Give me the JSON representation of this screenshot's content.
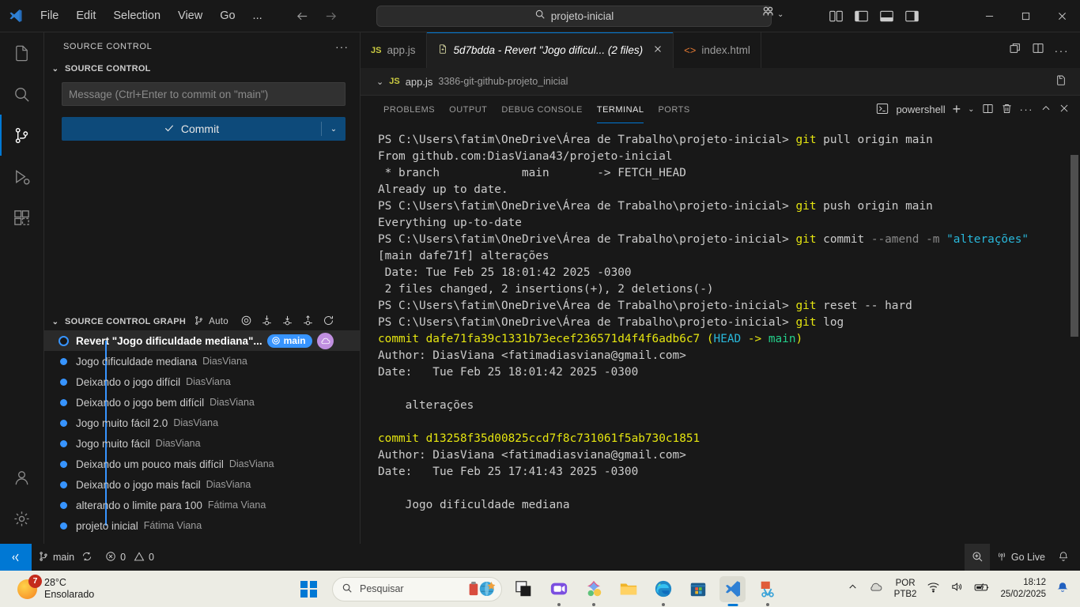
{
  "titlebar": {
    "menus": [
      "File",
      "Edit",
      "Selection",
      "View",
      "Go",
      "..."
    ],
    "back_icon": "arrow-left-icon",
    "forward_icon": "arrow-right-icon",
    "search_value": "projeto-inicial",
    "search_icon": "search-icon",
    "accounts_icon": "accounts-icon",
    "chevron": "⌄",
    "layout_icons": [
      "customize-layout-icon",
      "toggle-primary-sidebar-icon",
      "toggle-panel-icon",
      "toggle-secondary-sidebar-icon"
    ],
    "window_minimize": "─",
    "window_maximize": "☐",
    "window_close": "✕"
  },
  "activitybar": {
    "items": [
      {
        "name": "explorer",
        "icon": "files-icon",
        "active": false
      },
      {
        "name": "search",
        "icon": "search-icon",
        "active": false
      },
      {
        "name": "source-control",
        "icon": "source-control-icon",
        "active": true
      },
      {
        "name": "run-and-debug",
        "icon": "debug-icon",
        "active": false
      },
      {
        "name": "extensions",
        "icon": "extensions-icon",
        "active": false
      }
    ],
    "bottom": [
      {
        "name": "accounts",
        "icon": "account-icon"
      },
      {
        "name": "settings",
        "icon": "gear-icon"
      }
    ]
  },
  "sidebar": {
    "title": "SOURCE CONTROL",
    "more_actions": "···",
    "section_title": "SOURCE CONTROL",
    "commit_message_placeholder": "Message (Ctrl+Enter to commit on \"main\")",
    "commit_button_label": "Commit",
    "commit_check_icon": "check-icon",
    "commit_dropdown_icon": "chevron-down-icon",
    "graph": {
      "title": "SOURCE CONTROL GRAPH",
      "auto_label": "Auto",
      "branch_icon": "git-branch-icon",
      "action_icons": [
        "fetch-icon",
        "pull-icon",
        "pull-down-icon",
        "push-up-icon",
        "refresh-icon"
      ],
      "commits": [
        {
          "message": "Revert \"Jogo dificuldade mediana\"...",
          "author": "",
          "selected": true,
          "badge": "main",
          "badge_icon": "target-icon",
          "cloud_icon": "cloud-icon"
        },
        {
          "message": "Jogo dificuldade mediana",
          "author": "DiasViana",
          "selected": false
        },
        {
          "message": "Deixando o jogo difícil",
          "author": "DiasViana",
          "selected": false
        },
        {
          "message": "Deixando o jogo bem difícil",
          "author": "DiasViana",
          "selected": false
        },
        {
          "message": "Jogo muito fácil 2.0",
          "author": "DiasViana",
          "selected": false
        },
        {
          "message": "Jogo muito fácil",
          "author": "DiasViana",
          "selected": false
        },
        {
          "message": "Deixando um pouco mais difícil",
          "author": "DiasViana",
          "selected": false
        },
        {
          "message": "Deixando o jogo mais facil",
          "author": "DiasViana",
          "selected": false
        },
        {
          "message": "alterando o limite para 100",
          "author": "Fátima Viana",
          "selected": false
        },
        {
          "message": "projeto inicial",
          "author": "Fátima Viana",
          "selected": false
        }
      ]
    }
  },
  "editor": {
    "tabs": [
      {
        "label": "app.js",
        "icon": "js-file-icon",
        "active": false,
        "preview": false,
        "closable": false
      },
      {
        "label": "5d7bdda - Revert \"Jogo dificul... (2 files)",
        "icon": "multi-file-diff-icon",
        "active": true,
        "preview": true,
        "closable": true
      },
      {
        "label": "index.html",
        "icon": "html-file-icon",
        "active": false,
        "preview": false,
        "closable": false
      }
    ],
    "tab_actions": [
      "split-editor-right-icon",
      "split-editor-icon",
      "more-actions-icon"
    ],
    "breadcrumb": {
      "chevron": "⌄",
      "file_icon": "js-file-icon",
      "file": "app.js",
      "detail": "3386-git-github-projeto_inicial",
      "right_icon": "open-changes-icon"
    }
  },
  "panel": {
    "tabs": [
      "PROBLEMS",
      "OUTPUT",
      "DEBUG CONSOLE",
      "TERMINAL",
      "PORTS"
    ],
    "active_tab": "TERMINAL",
    "shell_name": "powershell",
    "shell_icon": "terminal-powershell-icon",
    "actions": [
      "new-terminal-icon",
      "chevron-down-icon",
      "split-terminal-icon",
      "trash-icon",
      "more-actions-icon",
      "chevron-up-icon",
      "close-icon"
    ]
  },
  "terminal": {
    "prompt": "PS C:\\Users\\fatim\\OneDrive\\Área de Trabalho\\projeto-inicial> ",
    "lines": [
      [
        {
          "t": "PS C:\\Users\\fatim\\OneDrive\\Área de Trabalho\\projeto-inicial> ",
          "c": "white"
        },
        {
          "t": "git",
          "c": "yellow"
        },
        {
          "t": " pull origin main",
          "c": "white"
        }
      ],
      [
        {
          "t": "From github.com:DiasViana43/projeto-inicial",
          "c": "white"
        }
      ],
      [
        {
          "t": " * branch            main       -> FETCH_HEAD",
          "c": "white"
        }
      ],
      [
        {
          "t": "Already up to date.",
          "c": "white"
        }
      ],
      [
        {
          "t": "PS C:\\Users\\fatim\\OneDrive\\Área de Trabalho\\projeto-inicial> ",
          "c": "white"
        },
        {
          "t": "git",
          "c": "yellow"
        },
        {
          "t": " push origin main",
          "c": "white"
        }
      ],
      [
        {
          "t": "Everything up-to-date",
          "c": "white"
        }
      ],
      [
        {
          "t": "PS C:\\Users\\fatim\\OneDrive\\Área de Trabalho\\projeto-inicial> ",
          "c": "white"
        },
        {
          "t": "git",
          "c": "yellow"
        },
        {
          "t": " commit ",
          "c": "white"
        },
        {
          "t": "--amend -m ",
          "c": "gray"
        },
        {
          "t": "\"alterações\"",
          "c": "cyan"
        }
      ],
      [
        {
          "t": "[main dafe71f] alterações",
          "c": "white"
        }
      ],
      [
        {
          "t": " Date: Tue Feb 25 18:01:42 2025 -0300",
          "c": "white"
        }
      ],
      [
        {
          "t": " 2 files changed, 2 insertions(+), 2 deletions(-)",
          "c": "white"
        }
      ],
      [
        {
          "t": "PS C:\\Users\\fatim\\OneDrive\\Área de Trabalho\\projeto-inicial> ",
          "c": "white"
        },
        {
          "t": "git",
          "c": "yellow"
        },
        {
          "t": " reset -- hard",
          "c": "white"
        }
      ],
      [
        {
          "t": "PS C:\\Users\\fatim\\OneDrive\\Área de Trabalho\\projeto-inicial> ",
          "c": "white"
        },
        {
          "t": "git",
          "c": "yellow"
        },
        {
          "t": " log",
          "c": "white"
        }
      ],
      [
        {
          "t": "commit dafe71fa39c1331b73ecef236571d4f4f6adb6c7 ",
          "c": "yellow"
        },
        {
          "t": "(",
          "c": "yellow"
        },
        {
          "t": "HEAD",
          "c": "cyan"
        },
        {
          "t": " -> ",
          "c": "yellow"
        },
        {
          "t": "main",
          "c": "green"
        },
        {
          "t": ")",
          "c": "yellow"
        }
      ],
      [
        {
          "t": "Author: DiasViana <fatimadiasviana@gmail.com>",
          "c": "white"
        }
      ],
      [
        {
          "t": "Date:   Tue Feb 25 18:01:42 2025 -0300",
          "c": "white"
        }
      ],
      [
        {
          "t": "",
          "c": "white"
        }
      ],
      [
        {
          "t": "    alterações",
          "c": "white"
        }
      ],
      [
        {
          "t": "",
          "c": "white"
        }
      ],
      [
        {
          "t": "commit d13258f35d00825ccd7f8c731061f5ab730c1851",
          "c": "yellow"
        }
      ],
      [
        {
          "t": "Author: DiasViana <fatimadiasviana@gmail.com>",
          "c": "white"
        }
      ],
      [
        {
          "t": "Date:   Tue Feb 25 17:41:43 2025 -0300",
          "c": "white"
        }
      ],
      [
        {
          "t": "",
          "c": "white"
        }
      ],
      [
        {
          "t": "    Jogo dificuldade mediana",
          "c": "white"
        }
      ]
    ]
  },
  "statusbar": {
    "remote_icon": "remote-window-icon",
    "branch_icon": "git-branch-icon",
    "branch": "main",
    "sync_icon": "sync-icon",
    "errors_icon": "error-icon",
    "errors": "0",
    "warnings_icon": "warning-icon",
    "warnings": "0",
    "zoom_icon": "screencast-icon",
    "golive_icon": "broadcast-icon",
    "golive_label": "Go Live",
    "bell_icon": "bell-icon"
  },
  "taskbar": {
    "weather_temp": "28°C",
    "weather_desc": "Ensolarado",
    "weather_badge": "7",
    "start_icon": "windows-start-icon",
    "search_placeholder": "Pesquisar",
    "search_icon": "search-icon",
    "apps": [
      {
        "name": "widgets-icon",
        "active": false
      },
      {
        "name": "task-view-icon",
        "active": false
      },
      {
        "name": "zoom-icon",
        "active": false
      },
      {
        "name": "copilot-icon",
        "active": false
      },
      {
        "name": "file-explorer-icon",
        "active": false
      },
      {
        "name": "edge-icon",
        "active": false
      },
      {
        "name": "microsoft-store-icon",
        "active": false
      },
      {
        "name": "vscode-icon",
        "active": true
      },
      {
        "name": "snipping-tool-icon",
        "active": false
      }
    ],
    "tray": {
      "chevron_icon": "show-hidden-icons-icon",
      "cloud_icon": "onedrive-icon",
      "lang_line1": "POR",
      "lang_line2": "PTB2",
      "wifi_icon": "wifi-icon",
      "volume_icon": "volume-icon",
      "battery_icon": "battery-icon",
      "time": "18:12",
      "date": "25/02/2025",
      "notify_icon": "bell-icon"
    }
  }
}
